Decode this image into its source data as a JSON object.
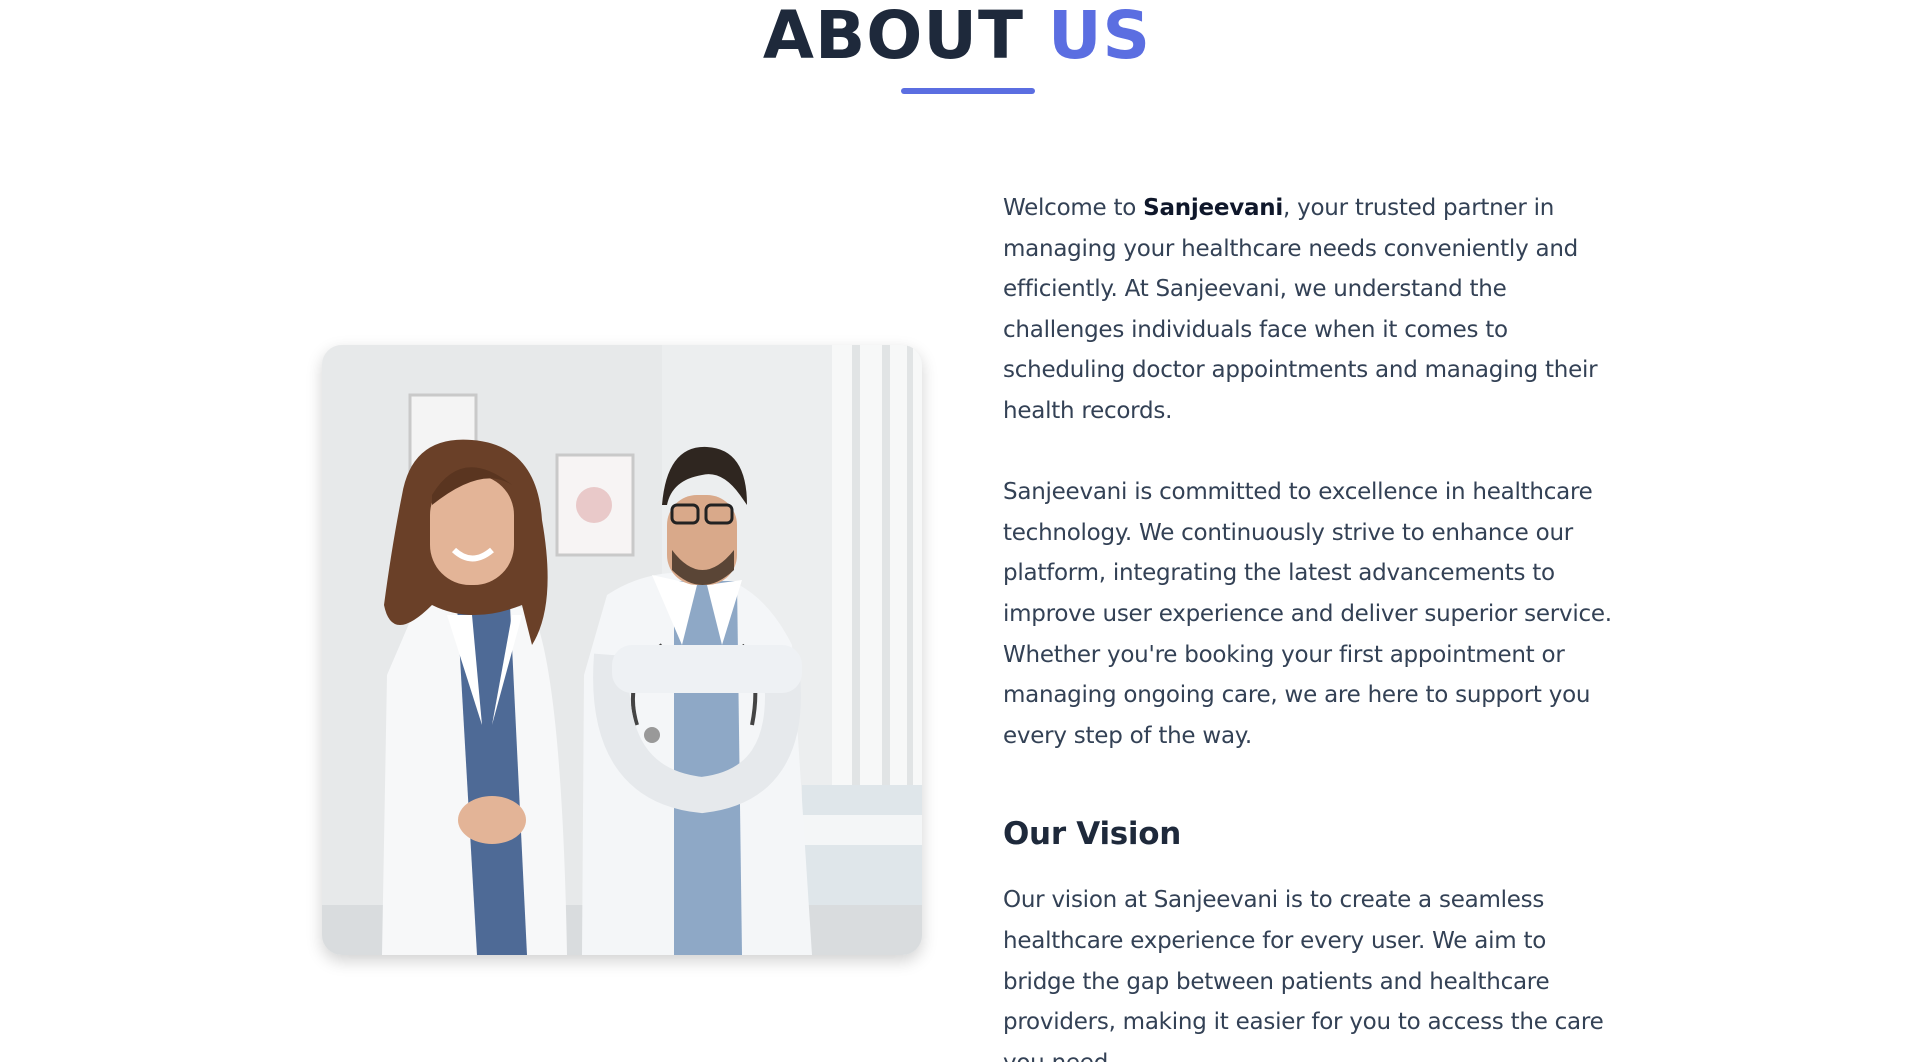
{
  "colors": {
    "accent": "#5b6ee1",
    "heading": "#1e293b",
    "body_text": "#334155"
  },
  "header": {
    "title_main": "ABOUT",
    "title_accent": "US"
  },
  "image": {
    "icon": "doctors-photo"
  },
  "intro": {
    "welcome_prefix": "Welcome to ",
    "brand": "Sanjeevani",
    "welcome_suffix": ", your trusted partner in managing your healthcare needs conveniently and efficiently. At Sanjeevani, we understand the challenges individuals face when it comes to scheduling doctor appointments and managing their health records."
  },
  "commitment": {
    "text": "Sanjeevani is committed to excellence in healthcare technology. We continuously strive to enhance our platform, integrating the latest advancements to improve user experience and deliver superior service. Whether you're booking your first appointment or managing ongoing care, we are here to support you every step of the way."
  },
  "vision": {
    "heading": "Our Vision",
    "text": "Our vision at Sanjeevani is to create a seamless healthcare experience for every user. We aim to bridge the gap between patients and healthcare providers, making it easier for you to access the care you need,"
  }
}
